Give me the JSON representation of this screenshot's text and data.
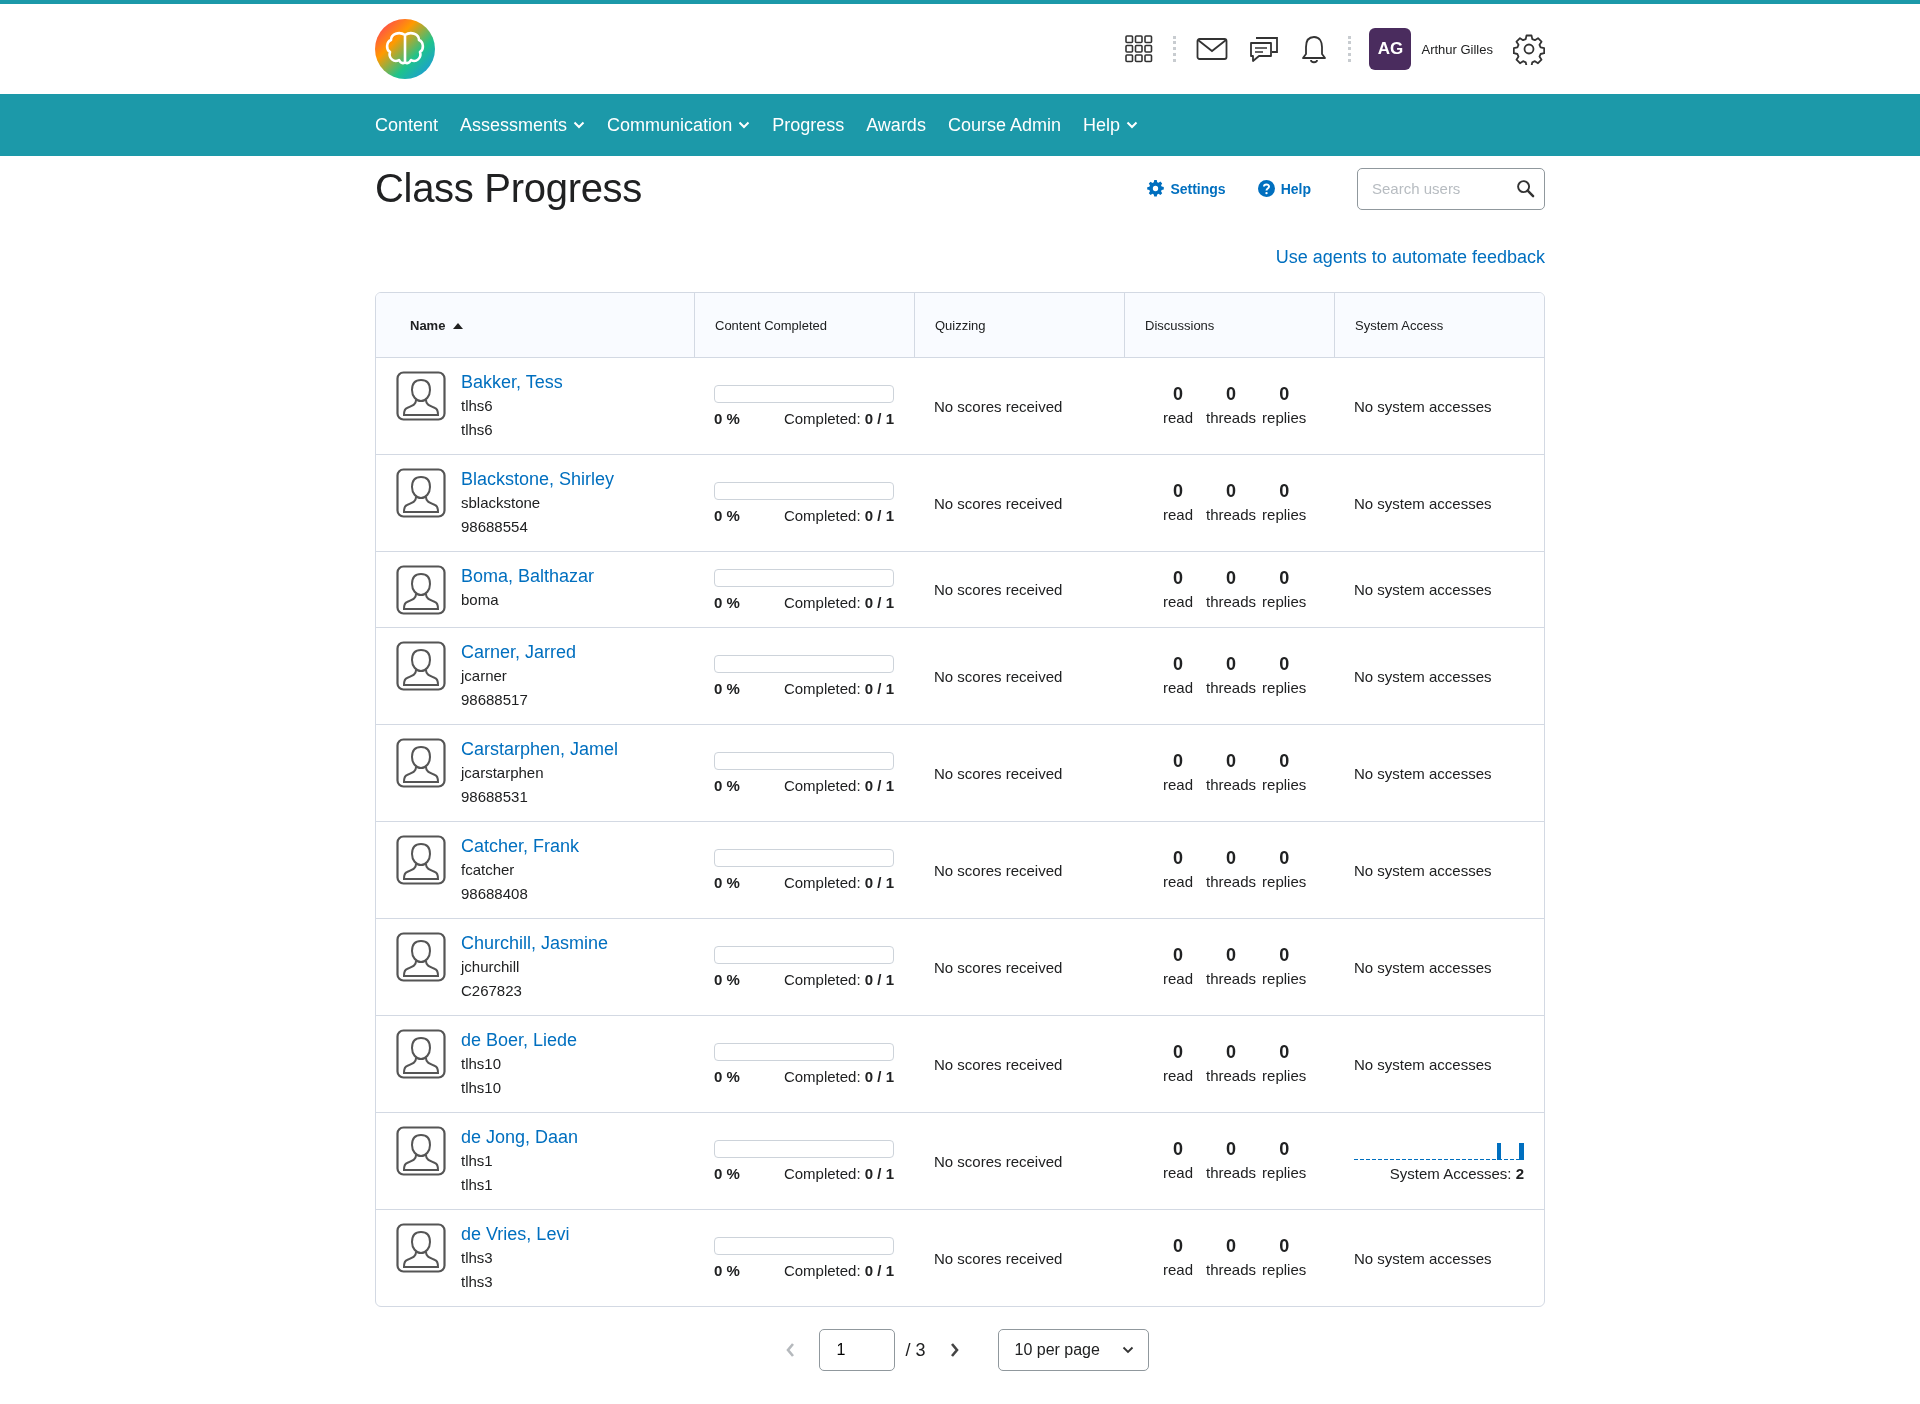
{
  "header": {
    "user_initials": "AG",
    "user_name": "Arthur Gilles"
  },
  "nav": [
    {
      "label": "Content",
      "has_menu": false
    },
    {
      "label": "Assessments",
      "has_menu": true
    },
    {
      "label": "Communication",
      "has_menu": true
    },
    {
      "label": "Progress",
      "has_menu": false
    },
    {
      "label": "Awards",
      "has_menu": false
    },
    {
      "label": "Course Admin",
      "has_menu": false
    },
    {
      "label": "Help",
      "has_menu": true
    }
  ],
  "page": {
    "title": "Class Progress",
    "settings_link": "Settings",
    "help_link": "Help",
    "search_placeholder": "Search users",
    "feedback_link": "Use agents to automate feedback"
  },
  "table": {
    "columns": [
      {
        "label": "Name",
        "sort_ascending": true
      },
      {
        "label": "Content Completed"
      },
      {
        "label": "Quizzing"
      },
      {
        "label": "Discussions"
      },
      {
        "label": "System Access"
      }
    ],
    "rows": [
      {
        "name": "Bakker, Tess",
        "ids": [
          "tlhs6",
          "tlhs6"
        ],
        "percent": "0 %",
        "completed_label": "Completed:",
        "completed": "0 / 1",
        "level": 0,
        "quizzing": "No scores received",
        "discussions": [
          {
            "count": "0",
            "label": "read"
          },
          {
            "count": "0",
            "label": "threads"
          },
          {
            "count": "0",
            "label": "replies"
          }
        ],
        "access": {
          "kind": "text",
          "text": "No system accesses"
        }
      },
      {
        "name": "Blackstone, Shirley",
        "ids": [
          "sblackstone",
          "98688554"
        ],
        "percent": "0 %",
        "completed_label": "Completed:",
        "completed": "0 / 1",
        "level": 0,
        "quizzing": "No scores received",
        "discussions": [
          {
            "count": "0",
            "label": "read"
          },
          {
            "count": "0",
            "label": "threads"
          },
          {
            "count": "0",
            "label": "replies"
          }
        ],
        "access": {
          "kind": "text",
          "text": "No system accesses"
        }
      },
      {
        "name": "Boma, Balthazar",
        "ids": [
          "boma"
        ],
        "percent": "0 %",
        "completed_label": "Completed:",
        "completed": "0 / 1",
        "level": 0,
        "quizzing": "No scores received",
        "discussions": [
          {
            "count": "0",
            "label": "read"
          },
          {
            "count": "0",
            "label": "threads"
          },
          {
            "count": "0",
            "label": "replies"
          }
        ],
        "access": {
          "kind": "text",
          "text": "No system accesses"
        }
      },
      {
        "name": "Carner, Jarred",
        "ids": [
          "jcarner",
          "98688517"
        ],
        "percent": "0 %",
        "completed_label": "Completed:",
        "completed": "0 / 1",
        "level": 0,
        "quizzing": "No scores received",
        "discussions": [
          {
            "count": "0",
            "label": "read"
          },
          {
            "count": "0",
            "label": "threads"
          },
          {
            "count": "0",
            "label": "replies"
          }
        ],
        "access": {
          "kind": "text",
          "text": "No system accesses"
        }
      },
      {
        "name": "Carstarphen, Jamel",
        "ids": [
          "jcarstarphen",
          "98688531"
        ],
        "percent": "0 %",
        "completed_label": "Completed:",
        "completed": "0 / 1",
        "level": 0,
        "quizzing": "No scores received",
        "discussions": [
          {
            "count": "0",
            "label": "read"
          },
          {
            "count": "0",
            "label": "threads"
          },
          {
            "count": "0",
            "label": "replies"
          }
        ],
        "access": {
          "kind": "text",
          "text": "No system accesses"
        }
      },
      {
        "name": "Catcher, Frank",
        "ids": [
          "fcatcher",
          "98688408"
        ],
        "percent": "0 %",
        "completed_label": "Completed:",
        "completed": "0 / 1",
        "level": 0,
        "quizzing": "No scores received",
        "discussions": [
          {
            "count": "0",
            "label": "read"
          },
          {
            "count": "0",
            "label": "threads"
          },
          {
            "count": "0",
            "label": "replies"
          }
        ],
        "access": {
          "kind": "text",
          "text": "No system accesses"
        }
      },
      {
        "name": "Churchill, Jasmine",
        "ids": [
          "jchurchill",
          "C267823"
        ],
        "percent": "0 %",
        "completed_label": "Completed:",
        "completed": "0 / 1",
        "level": 0,
        "quizzing": "No scores received",
        "discussions": [
          {
            "count": "0",
            "label": "read"
          },
          {
            "count": "0",
            "label": "threads"
          },
          {
            "count": "0",
            "label": "replies"
          }
        ],
        "access": {
          "kind": "text",
          "text": "No system accesses"
        }
      },
      {
        "name": "de Boer, Liede",
        "ids": [
          "tlhs10",
          "tlhs10"
        ],
        "percent": "0 %",
        "completed_label": "Completed:",
        "completed": "0 / 1",
        "level": 0,
        "quizzing": "No scores received",
        "discussions": [
          {
            "count": "0",
            "label": "read"
          },
          {
            "count": "0",
            "label": "threads"
          },
          {
            "count": "0",
            "label": "replies"
          }
        ],
        "access": {
          "kind": "text",
          "text": "No system accesses"
        }
      },
      {
        "name": "de Jong, Daan",
        "ids": [
          "tlhs1",
          "tlhs1"
        ],
        "percent": "0 %",
        "completed_label": "Completed:",
        "completed": "0 / 1",
        "level": 0,
        "quizzing": "No scores received",
        "discussions": [
          {
            "count": "0",
            "label": "read"
          },
          {
            "count": "0",
            "label": "threads"
          },
          {
            "count": "0",
            "label": "replies"
          }
        ],
        "access": {
          "kind": "sparkline",
          "label": "System Accesses:",
          "count": "2"
        }
      },
      {
        "name": "de Vries, Levi",
        "ids": [
          "tlhs3",
          "tlhs3"
        ],
        "percent": "0 %",
        "completed_label": "Completed:",
        "completed": "0 / 1",
        "level": 0,
        "quizzing": "No scores received",
        "discussions": [
          {
            "count": "0",
            "label": "read"
          },
          {
            "count": "0",
            "label": "threads"
          },
          {
            "count": "0",
            "label": "replies"
          }
        ],
        "access": {
          "kind": "text",
          "text": "No system accesses"
        }
      }
    ]
  },
  "pagination": {
    "prev_disabled": true,
    "page": "1",
    "total": "/ 3",
    "next_disabled": false,
    "per_page": "10 per page"
  }
}
